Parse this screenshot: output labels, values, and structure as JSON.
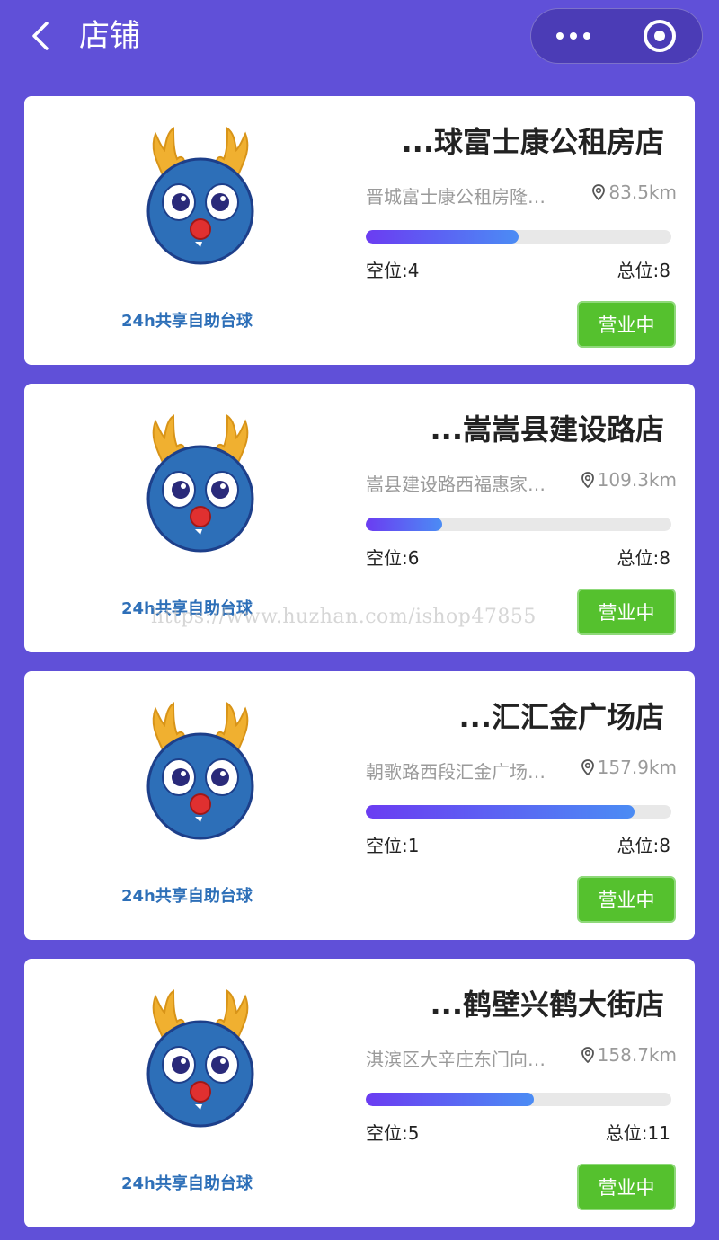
{
  "header": {
    "title": "店铺",
    "back_icon": "back-chevron-icon",
    "more_icon": "more-dots-icon",
    "close_icon": "target-circle-icon",
    "text_color": "#ffffff",
    "background": "#6050d8"
  },
  "stores": [
    {
      "name": "...球富士康公租房店",
      "address": "晋城富士康公租房隆…",
      "distance": "83.5km",
      "free_label": "空位:4",
      "total_label": "总位:8",
      "occupancy_ratio": 0.5,
      "status": "营业中",
      "logo_text": "24h共享自助台球"
    },
    {
      "name": "...嵩嵩县建设路店",
      "address": "嵩县建设路西福惠家…",
      "distance": "109.3km",
      "free_label": "空位:6",
      "total_label": "总位:8",
      "occupancy_ratio": 0.25,
      "status": "营业中",
      "logo_text": "24h共享自助台球"
    },
    {
      "name": "...汇汇金广场店",
      "address": "朝歌路西段汇金广场…",
      "distance": "157.9km",
      "free_label": "空位:1",
      "total_label": "总位:8",
      "occupancy_ratio": 0.875,
      "status": "营业中",
      "logo_text": "24h共享自助台球"
    },
    {
      "name": "...鹤壁兴鹤大街店",
      "address": "淇滨区大辛庄东门向…",
      "distance": "158.7km",
      "free_label": "空位:5",
      "total_label": "总位:11",
      "occupancy_ratio": 0.545,
      "status": "营业中",
      "logo_text": "24h共享自助台球"
    }
  ],
  "watermark": "https://www.huzhan.com/ishop47855",
  "colors": {
    "status_green": "#55c12e",
    "bar_start": "#6b3cf2",
    "bar_end": "#4b8cf4",
    "mascot_blue": "#2d6fb8",
    "antler": "#f0b030",
    "nose": "#e03030"
  },
  "icons": {
    "location": "location-pin-icon",
    "mascot": "reindeer-mascot-logo"
  }
}
